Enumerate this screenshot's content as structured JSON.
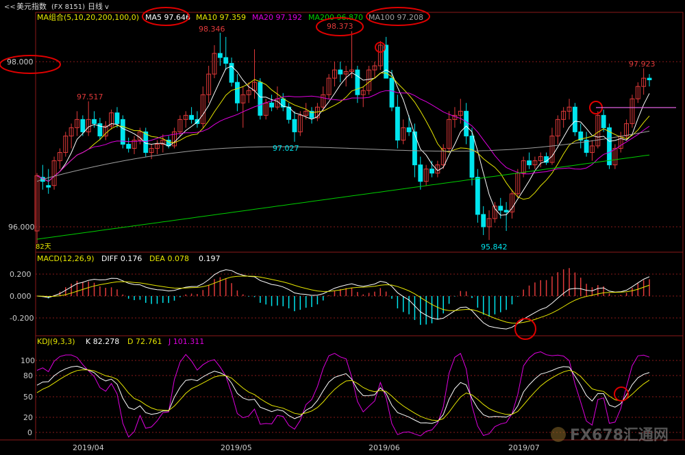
{
  "header": {
    "back_glyph": "<<",
    "title": "美元指数",
    "code": "(FX 8151)",
    "period": "日线",
    "dropdown_glyph": "v"
  },
  "theme": {
    "background": "#000000",
    "frame": "#8b1a1a",
    "dashed_grid": "#8b1a1a",
    "up_candle": "#e23a3a",
    "down_candle": "#00e5ee",
    "text": "#cccccc",
    "circle": "#e00000"
  },
  "main_panel": {
    "indicator_title": "MA组合(5,10,20,200,100,0)",
    "ma_labels": [
      {
        "name": "MA5",
        "value": "97.646",
        "color": "#ffffff"
      },
      {
        "name": "MA10",
        "value": "97.359",
        "color": "#e8e800"
      },
      {
        "name": "MA20",
        "value": "97.192",
        "color": "#e000e0"
      },
      {
        "name": "MA200",
        "value": "96.870",
        "color": "#00d000"
      },
      {
        "name": "MA100",
        "value": "97.208",
        "color": "#a0a0a0"
      }
    ],
    "axis_labels": [
      "98.000",
      "96.000"
    ],
    "annotations": [
      "97.517",
      "98.346",
      "97.027",
      "98.373",
      "95.842",
      "97.923"
    ],
    "bottom_tag": "82天"
  },
  "macd_panel": {
    "title": "MACD(12,26,9)",
    "diff_label": "DIFF",
    "diff_value": "0.176",
    "dea_label": "DEA",
    "dea_value": "0.078",
    "macd_value": "0.197",
    "axis_labels": [
      "0.200",
      "0.000",
      "-0.200"
    ]
  },
  "kdj_panel": {
    "title": "KDJ(9,3,3)",
    "k_label": "K",
    "k_value": "82.278",
    "d_label": "D",
    "d_value": "72.761",
    "j_label": "J",
    "j_value": "101.311",
    "axis_labels": [
      "100",
      "80",
      "50",
      "20",
      "0"
    ]
  },
  "x_axis": [
    "2019/04",
    "2019/05",
    "2019/06",
    "2019/07"
  ],
  "watermark": "FX678汇通网",
  "chart_data": {
    "type": "candlestick",
    "x_range": [
      "2019/03/21",
      "2019/07/26"
    ],
    "ylim": [
      95.6,
      98.6
    ],
    "candles": [
      {
        "o": 95.95,
        "h": 96.65,
        "l": 95.8,
        "c": 96.62
      },
      {
        "o": 96.6,
        "h": 96.75,
        "l": 96.45,
        "c": 96.55
      },
      {
        "o": 96.5,
        "h": 96.7,
        "l": 96.4,
        "c": 96.48
      },
      {
        "o": 96.5,
        "h": 96.85,
        "l": 96.45,
        "c": 96.8
      },
      {
        "o": 96.8,
        "h": 96.95,
        "l": 96.7,
        "c": 96.9
      },
      {
        "o": 96.9,
        "h": 97.15,
        "l": 96.85,
        "c": 97.1
      },
      {
        "o": 97.1,
        "h": 97.25,
        "l": 96.95,
        "c": 97.2
      },
      {
        "o": 97.2,
        "h": 97.4,
        "l": 97.1,
        "c": 97.3
      },
      {
        "o": 97.3,
        "h": 97.35,
        "l": 97.1,
        "c": 97.15
      },
      {
        "o": 97.15,
        "h": 97.52,
        "l": 97.1,
        "c": 97.3
      },
      {
        "o": 97.3,
        "h": 97.4,
        "l": 97.2,
        "c": 97.25
      },
      {
        "o": 97.25,
        "h": 97.32,
        "l": 97.05,
        "c": 97.1
      },
      {
        "o": 97.1,
        "h": 97.28,
        "l": 97.05,
        "c": 97.22
      },
      {
        "o": 97.22,
        "h": 97.42,
        "l": 97.18,
        "c": 97.38
      },
      {
        "o": 97.38,
        "h": 97.45,
        "l": 97.2,
        "c": 97.25
      },
      {
        "o": 97.3,
        "h": 97.35,
        "l": 96.95,
        "c": 97.0
      },
      {
        "o": 97.0,
        "h": 97.08,
        "l": 96.9,
        "c": 96.95
      },
      {
        "o": 96.95,
        "h": 97.1,
        "l": 96.88,
        "c": 97.05
      },
      {
        "o": 97.05,
        "h": 97.2,
        "l": 97.0,
        "c": 97.15
      },
      {
        "o": 97.15,
        "h": 97.2,
        "l": 96.85,
        "c": 96.9
      },
      {
        "o": 96.9,
        "h": 97.0,
        "l": 96.82,
        "c": 96.95
      },
      {
        "o": 96.95,
        "h": 97.05,
        "l": 96.88,
        "c": 97.0
      },
      {
        "o": 97.0,
        "h": 97.12,
        "l": 96.9,
        "c": 97.05
      },
      {
        "o": 97.05,
        "h": 97.1,
        "l": 96.95,
        "c": 96.98
      },
      {
        "o": 96.98,
        "h": 97.2,
        "l": 96.95,
        "c": 97.15
      },
      {
        "o": 97.15,
        "h": 97.35,
        "l": 97.1,
        "c": 97.3
      },
      {
        "o": 97.3,
        "h": 97.4,
        "l": 97.2,
        "c": 97.35
      },
      {
        "o": 97.35,
        "h": 97.45,
        "l": 97.25,
        "c": 97.3
      },
      {
        "o": 97.3,
        "h": 97.4,
        "l": 97.2,
        "c": 97.25
      },
      {
        "o": 97.25,
        "h": 97.7,
        "l": 97.2,
        "c": 97.6
      },
      {
        "o": 97.6,
        "h": 97.95,
        "l": 97.5,
        "c": 97.85
      },
      {
        "o": 97.85,
        "h": 98.2,
        "l": 97.8,
        "c": 98.1
      },
      {
        "o": 98.1,
        "h": 98.35,
        "l": 97.95,
        "c": 98.05
      },
      {
        "o": 98.05,
        "h": 98.3,
        "l": 97.9,
        "c": 97.98
      },
      {
        "o": 97.98,
        "h": 98.05,
        "l": 97.7,
        "c": 97.75
      },
      {
        "o": 97.75,
        "h": 97.85,
        "l": 97.4,
        "c": 97.5
      },
      {
        "o": 97.5,
        "h": 97.7,
        "l": 97.2,
        "c": 97.6
      },
      {
        "o": 97.6,
        "h": 97.75,
        "l": 97.5,
        "c": 97.65
      },
      {
        "o": 97.65,
        "h": 98.15,
        "l": 97.55,
        "c": 97.75
      },
      {
        "o": 97.75,
        "h": 97.8,
        "l": 97.3,
        "c": 97.35
      },
      {
        "o": 97.35,
        "h": 97.55,
        "l": 97.3,
        "c": 97.5
      },
      {
        "o": 97.5,
        "h": 97.6,
        "l": 97.4,
        "c": 97.45
      },
      {
        "o": 97.45,
        "h": 97.7,
        "l": 97.42,
        "c": 97.55
      },
      {
        "o": 97.55,
        "h": 97.62,
        "l": 97.4,
        "c": 97.45
      },
      {
        "o": 97.45,
        "h": 97.5,
        "l": 97.25,
        "c": 97.3
      },
      {
        "o": 97.3,
        "h": 97.4,
        "l": 97.03,
        "c": 97.15
      },
      {
        "o": 97.15,
        "h": 97.4,
        "l": 97.1,
        "c": 97.35
      },
      {
        "o": 97.35,
        "h": 97.5,
        "l": 97.3,
        "c": 97.4
      },
      {
        "o": 97.4,
        "h": 97.45,
        "l": 97.25,
        "c": 97.32
      },
      {
        "o": 97.32,
        "h": 97.5,
        "l": 97.28,
        "c": 97.45
      },
      {
        "o": 97.45,
        "h": 97.7,
        "l": 97.4,
        "c": 97.6
      },
      {
        "o": 97.6,
        "h": 97.85,
        "l": 97.55,
        "c": 97.8
      },
      {
        "o": 97.8,
        "h": 98.0,
        "l": 97.7,
        "c": 97.9
      },
      {
        "o": 97.9,
        "h": 98.0,
        "l": 97.75,
        "c": 97.85
      },
      {
        "o": 97.85,
        "h": 97.95,
        "l": 97.7,
        "c": 97.88
      },
      {
        "o": 97.88,
        "h": 98.37,
        "l": 97.8,
        "c": 97.9
      },
      {
        "o": 97.9,
        "h": 97.95,
        "l": 97.5,
        "c": 97.6
      },
      {
        "o": 97.6,
        "h": 97.7,
        "l": 97.45,
        "c": 97.65
      },
      {
        "o": 97.65,
        "h": 97.95,
        "l": 97.6,
        "c": 97.9
      },
      {
        "o": 97.9,
        "h": 98.0,
        "l": 97.8,
        "c": 97.95
      },
      {
        "o": 97.95,
        "h": 98.25,
        "l": 97.9,
        "c": 98.2
      },
      {
        "o": 98.2,
        "h": 98.3,
        "l": 97.9,
        "c": 97.8
      },
      {
        "o": 97.8,
        "h": 97.9,
        "l": 97.4,
        "c": 97.45
      },
      {
        "o": 97.45,
        "h": 97.6,
        "l": 96.95,
        "c": 97.05
      },
      {
        "o": 97.05,
        "h": 97.3,
        "l": 97.0,
        "c": 97.2
      },
      {
        "o": 97.2,
        "h": 97.35,
        "l": 97.1,
        "c": 97.15
      },
      {
        "o": 97.15,
        "h": 97.25,
        "l": 96.6,
        "c": 96.75
      },
      {
        "o": 96.75,
        "h": 96.85,
        "l": 96.45,
        "c": 96.55
      },
      {
        "o": 96.55,
        "h": 96.75,
        "l": 96.5,
        "c": 96.7
      },
      {
        "o": 96.7,
        "h": 96.8,
        "l": 96.6,
        "c": 96.65
      },
      {
        "o": 96.65,
        "h": 96.8,
        "l": 96.6,
        "c": 96.75
      },
      {
        "o": 96.75,
        "h": 97.0,
        "l": 96.7,
        "c": 96.95
      },
      {
        "o": 96.95,
        "h": 97.4,
        "l": 96.9,
        "c": 97.3
      },
      {
        "o": 97.3,
        "h": 97.45,
        "l": 97.2,
        "c": 97.35
      },
      {
        "o": 97.35,
        "h": 97.55,
        "l": 97.25,
        "c": 97.4
      },
      {
        "o": 97.4,
        "h": 97.5,
        "l": 97.0,
        "c": 97.1
      },
      {
        "o": 97.1,
        "h": 97.2,
        "l": 96.5,
        "c": 96.6
      },
      {
        "o": 96.6,
        "h": 96.7,
        "l": 96.05,
        "c": 96.15
      },
      {
        "o": 96.15,
        "h": 96.25,
        "l": 95.9,
        "c": 96.0
      },
      {
        "o": 96.0,
        "h": 96.2,
        "l": 95.84,
        "c": 96.1
      },
      {
        "o": 96.1,
        "h": 96.3,
        "l": 96.05,
        "c": 96.25
      },
      {
        "o": 96.25,
        "h": 96.35,
        "l": 96.1,
        "c": 96.2
      },
      {
        "o": 96.2,
        "h": 96.3,
        "l": 95.95,
        "c": 96.18
      },
      {
        "o": 96.18,
        "h": 96.45,
        "l": 96.1,
        "c": 96.4
      },
      {
        "o": 96.4,
        "h": 96.7,
        "l": 96.35,
        "c": 96.65
      },
      {
        "o": 96.65,
        "h": 96.85,
        "l": 96.6,
        "c": 96.8
      },
      {
        "o": 96.8,
        "h": 96.9,
        "l": 96.7,
        "c": 96.75
      },
      {
        "o": 96.75,
        "h": 96.85,
        "l": 96.7,
        "c": 96.8
      },
      {
        "o": 96.8,
        "h": 96.9,
        "l": 96.72,
        "c": 96.85
      },
      {
        "o": 96.85,
        "h": 96.9,
        "l": 96.75,
        "c": 96.78
      },
      {
        "o": 96.78,
        "h": 97.2,
        "l": 96.75,
        "c": 97.1
      },
      {
        "o": 97.1,
        "h": 97.35,
        "l": 97.0,
        "c": 97.3
      },
      {
        "o": 97.3,
        "h": 97.45,
        "l": 97.2,
        "c": 97.4
      },
      {
        "o": 97.4,
        "h": 97.55,
        "l": 97.3,
        "c": 97.45
      },
      {
        "o": 97.45,
        "h": 97.5,
        "l": 97.1,
        "c": 97.15
      },
      {
        "o": 97.15,
        "h": 97.25,
        "l": 96.95,
        "c": 97.05
      },
      {
        "o": 97.05,
        "h": 97.15,
        "l": 96.85,
        "c": 96.9
      },
      {
        "o": 96.9,
        "h": 97.05,
        "l": 96.8,
        "c": 96.98
      },
      {
        "o": 96.98,
        "h": 97.4,
        "l": 96.95,
        "c": 97.35
      },
      {
        "o": 97.35,
        "h": 97.42,
        "l": 97.15,
        "c": 97.2
      },
      {
        "o": 97.2,
        "h": 97.25,
        "l": 96.7,
        "c": 96.75
      },
      {
        "o": 96.75,
        "h": 97.0,
        "l": 96.7,
        "c": 96.95
      },
      {
        "o": 96.95,
        "h": 97.15,
        "l": 96.9,
        "c": 97.1
      },
      {
        "o": 97.1,
        "h": 97.3,
        "l": 97.05,
        "c": 97.25
      },
      {
        "o": 97.25,
        "h": 97.6,
        "l": 97.2,
        "c": 97.55
      },
      {
        "o": 97.55,
        "h": 97.75,
        "l": 97.5,
        "c": 97.7
      },
      {
        "o": 97.7,
        "h": 97.92,
        "l": 97.6,
        "c": 97.8
      },
      {
        "o": 97.8,
        "h": 97.85,
        "l": 97.7,
        "c": 97.78
      }
    ],
    "ma_levels_last": {
      "MA5": 97.646,
      "MA10": 97.359,
      "MA20": 97.192,
      "MA200": 96.87,
      "MA100": 97.208
    },
    "macd": {
      "diff_last": 0.176,
      "dea_last": 0.078,
      "macd_last": 0.197,
      "ylim": [
        -0.35,
        0.35
      ]
    },
    "kdj": {
      "k_last": 82.278,
      "d_last": 72.761,
      "j_last": 101.311,
      "ylim": [
        -10,
        115
      ]
    }
  }
}
